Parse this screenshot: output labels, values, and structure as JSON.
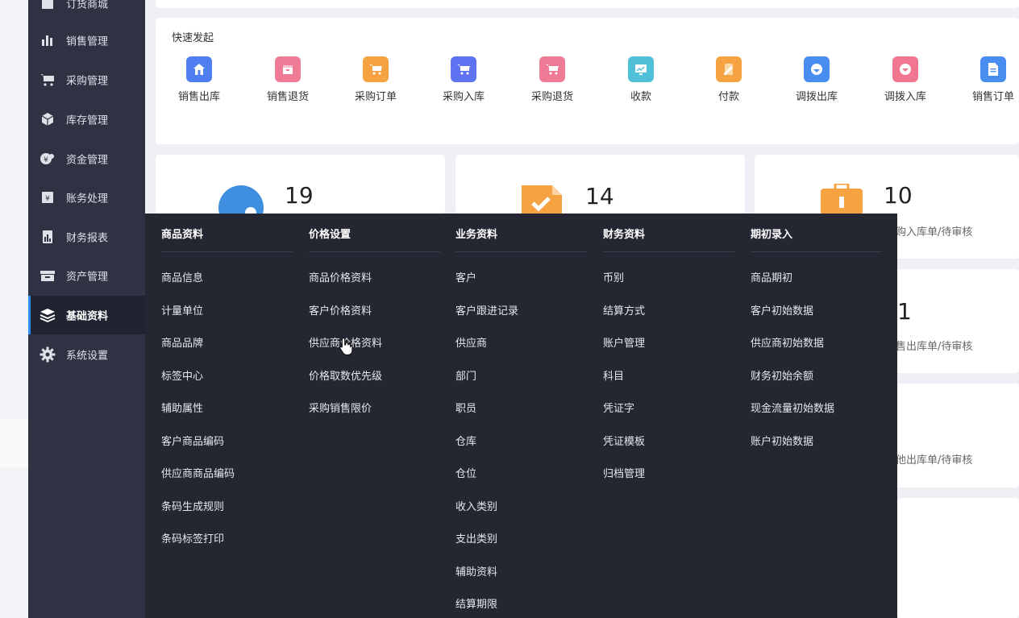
{
  "sidebar": {
    "items": [
      {
        "label": "订货商城",
        "icon": "store-icon"
      },
      {
        "label": "销售管理",
        "icon": "bar-chart-icon"
      },
      {
        "label": "采购管理",
        "icon": "cart-icon"
      },
      {
        "label": "库存管理",
        "icon": "box-icon"
      },
      {
        "label": "资金管理",
        "icon": "money-icon"
      },
      {
        "label": "账务处理",
        "icon": "ledger-icon"
      },
      {
        "label": "财务报表",
        "icon": "report-icon"
      },
      {
        "label": "资产管理",
        "icon": "asset-icon"
      },
      {
        "label": "基础资料",
        "icon": "layers-icon"
      },
      {
        "label": "系统设置",
        "icon": "gear-icon"
      }
    ],
    "active": "基础资料"
  },
  "quick": {
    "title": "快速发起",
    "items": [
      {
        "label": "销售出库",
        "color": "#4e7ef0",
        "icon": "home-icon"
      },
      {
        "label": "销售退货",
        "color": "#ef7a96",
        "icon": "return-box-icon"
      },
      {
        "label": "采购订单",
        "color": "#f5a342",
        "icon": "cart-icon"
      },
      {
        "label": "采购入库",
        "color": "#5d73f2",
        "icon": "cart-in-icon"
      },
      {
        "label": "采购退货",
        "color": "#ef7a96",
        "icon": "cart-return-icon"
      },
      {
        "label": "收款",
        "color": "#4fc0d8",
        "icon": "receive-icon"
      },
      {
        "label": "付款",
        "color": "#f5a342",
        "icon": "pay-icon"
      },
      {
        "label": "调拨出库",
        "color": "#4a8df0",
        "icon": "transfer-out-icon"
      },
      {
        "label": "调拨入库",
        "color": "#f0778f",
        "icon": "transfer-in-icon"
      },
      {
        "label": "销售订单",
        "color": "#4a8df0",
        "icon": "document-icon"
      }
    ]
  },
  "stats": [
    {
      "number": "19"
    },
    {
      "number": "14"
    },
    {
      "number": "10",
      "desc": "购入库单/待审核"
    },
    {
      "number": "1",
      "desc": "售出库单/待审核"
    },
    {
      "desc": "他出库单/待审核"
    }
  ],
  "menu": {
    "columns": [
      {
        "title": "商品资料",
        "items": [
          "商品信息",
          "计量单位",
          "商品品牌",
          "标签中心",
          "辅助属性",
          "客户商品编码",
          "供应商商品编码",
          "条码生成规则",
          "条码标签打印"
        ]
      },
      {
        "title": "价格设置",
        "items": [
          "商品价格资料",
          "客户价格资料",
          "供应商价格资料",
          "价格取数优先级",
          "采购销售限价"
        ]
      },
      {
        "title": "业务资料",
        "items": [
          "客户",
          "客户跟进记录",
          "供应商",
          "部门",
          "职员",
          "仓库",
          "仓位",
          "收入类别",
          "支出类别",
          "辅助资料",
          "结算期限"
        ]
      },
      {
        "title": "财务资料",
        "items": [
          "币别",
          "结算方式",
          "账户管理",
          "科目",
          "凭证字",
          "凭证模板",
          "归档管理"
        ]
      },
      {
        "title": "期初录入",
        "items": [
          "商品期初",
          "客户初始数据",
          "供应商初始数据",
          "财务初始余额",
          "现金流量初始数据",
          "账户初始数据"
        ]
      }
    ]
  }
}
